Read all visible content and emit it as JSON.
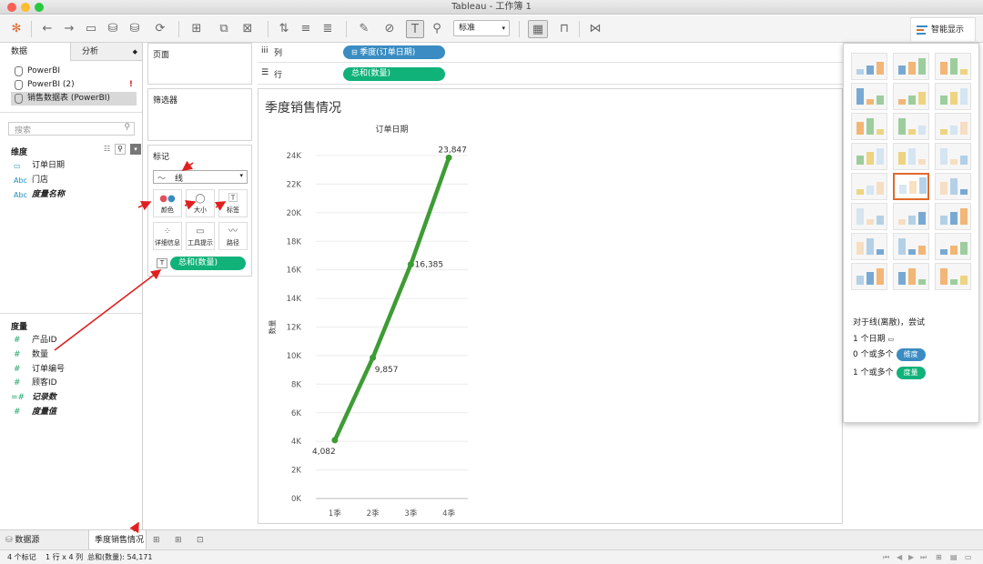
{
  "window": {
    "title": "Tableau - 工作簿 1"
  },
  "toolbar": {
    "fit_select": "标准",
    "show_me_label": "智能显示"
  },
  "left_panel": {
    "tabs": [
      "数据",
      "分析"
    ],
    "datasources": [
      "PowerBI",
      "PowerBI (2)",
      "销售数据表 (PowerBI)"
    ],
    "warning_mark": "!",
    "search_placeholder": "搜索",
    "dimensions_header": "维度",
    "dimensions": [
      {
        "type": "date",
        "type_label": "",
        "name": "订单日期"
      },
      {
        "type": "text",
        "type_label": "Abc",
        "name": "门店"
      },
      {
        "type": "text",
        "type_label": "Abc",
        "name": "度量名称"
      }
    ],
    "measures_header": "度量",
    "measures": [
      {
        "type_label": "#",
        "name": "产品ID"
      },
      {
        "type_label": "#",
        "name": "数量"
      },
      {
        "type_label": "#",
        "name": "订单编号"
      },
      {
        "type_label": "#",
        "name": "顾客ID"
      },
      {
        "type_label": "=#",
        "name": "记录数"
      },
      {
        "type_label": "#",
        "name": "度量值"
      }
    ]
  },
  "pages_card": {
    "label": "页面"
  },
  "filters_card": {
    "label": "筛选器"
  },
  "marks_card": {
    "label": "标记",
    "mark_type": "线",
    "buttons": [
      "颜色",
      "大小",
      "标签",
      "详细信息",
      "工具提示",
      "路径"
    ],
    "label_pill": "总和(数量)"
  },
  "shelves": {
    "columns_label": "列",
    "columns_pill": "季度(订单日期)",
    "rows_label": "行",
    "rows_pill": "总和(数量)"
  },
  "view": {
    "title": "季度销售情况"
  },
  "chart_data": {
    "type": "line",
    "title": "季度销售情况",
    "header": "订单日期",
    "categories": [
      "1季",
      "2季",
      "3季",
      "4季"
    ],
    "values": [
      4082,
      9857,
      16385,
      23847
    ],
    "value_labels": [
      "4,082",
      "9,857",
      "16,385",
      "23,847"
    ],
    "ylabel": "数量",
    "ylim": [
      0,
      24000
    ],
    "yticks": [
      "0K",
      "2K",
      "4K",
      "6K",
      "8K",
      "10K",
      "12K",
      "14K",
      "16K",
      "18K",
      "20K",
      "22K",
      "24K"
    ],
    "line_color": "#3e9c35",
    "grid": true
  },
  "showme": {
    "hint": "对于线(离散)，尝试",
    "req1": "1 个日期",
    "req2_prefix": "0 个或多个",
    "req2_pill": "维度",
    "req3_prefix": "1 个或多个",
    "req3_pill": "度量"
  },
  "bottom_tabs": {
    "datasource": "数据源",
    "sheet": "季度销售情况"
  },
  "status": {
    "marks": "4 个标记",
    "rows_cols": "1 行 x 4 列",
    "sum": "总和(数量): 54,171"
  },
  "colors": {
    "dimension_blue": "#3a8cc2",
    "measure_green": "#10b27a",
    "annotation_red": "#e02020"
  }
}
